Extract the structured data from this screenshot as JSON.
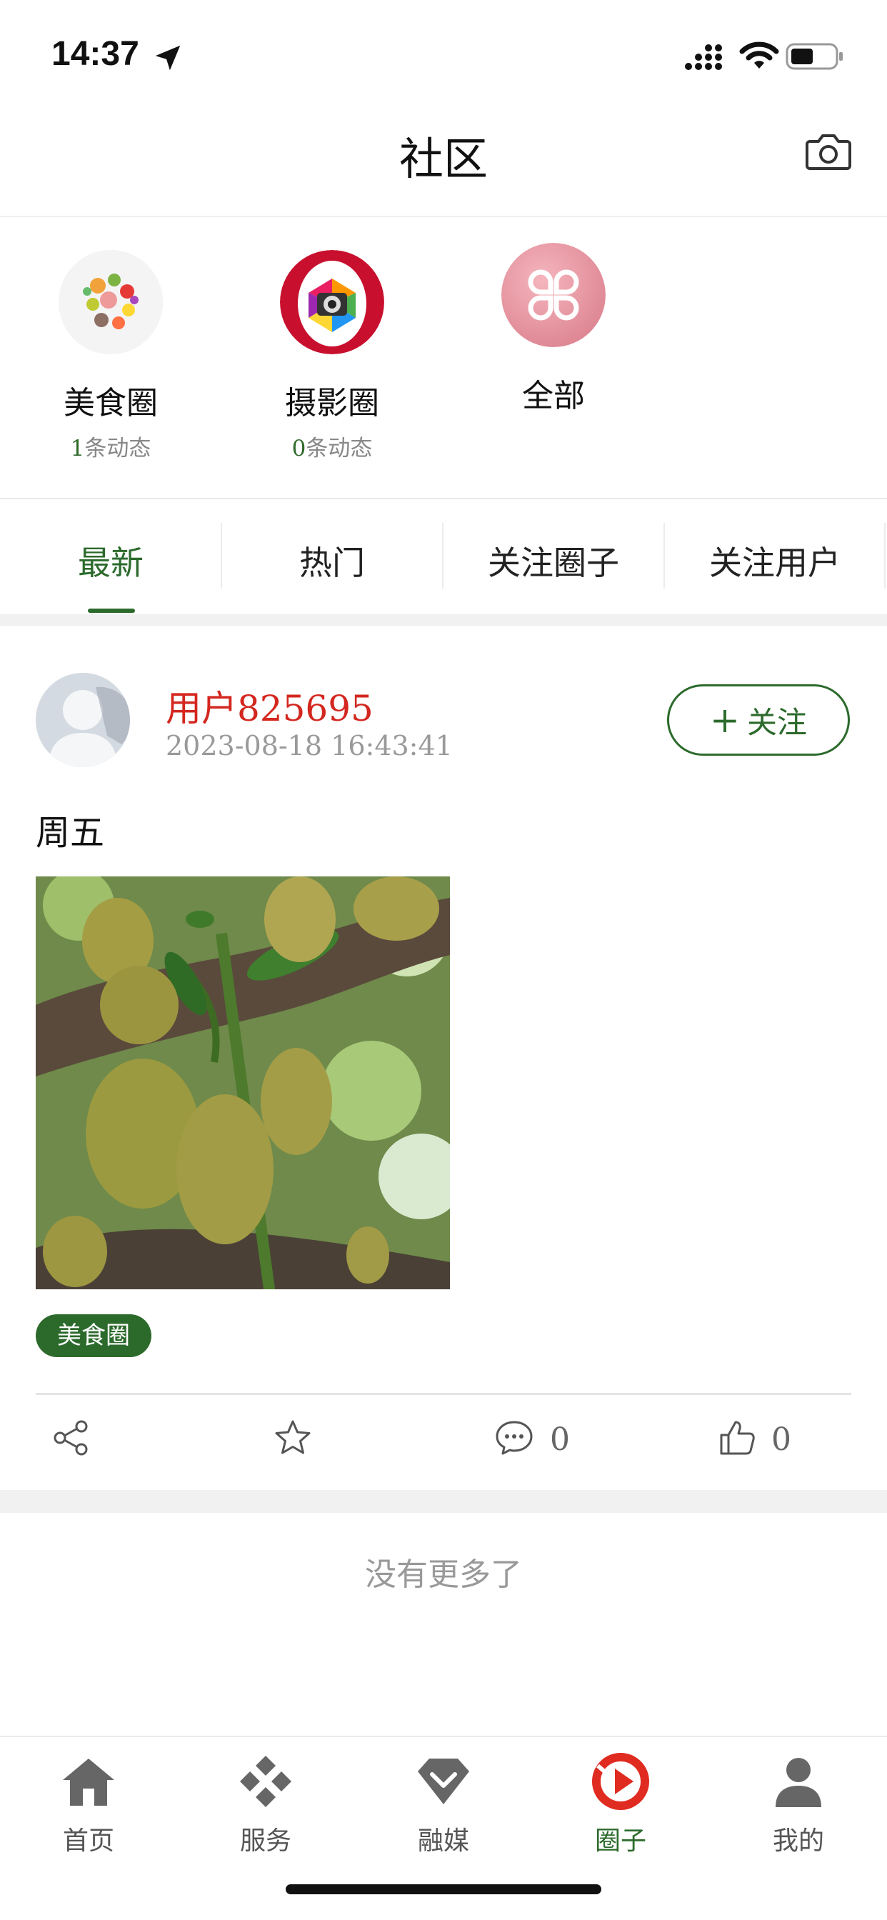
{
  "status_bar": {
    "time": "14:37"
  },
  "header": {
    "title": "社区"
  },
  "circles": [
    {
      "name": "美食圈",
      "count": "1",
      "count_suffix": "条动态"
    },
    {
      "name": "摄影圈",
      "count": "0",
      "count_suffix": "条动态"
    },
    {
      "name": "全部"
    }
  ],
  "tabs": [
    {
      "label": "最新",
      "active": true
    },
    {
      "label": "热门"
    },
    {
      "label": "关注圈子"
    },
    {
      "label": "关注用户"
    }
  ],
  "post": {
    "username": "用户825695",
    "time": "2023-08-18 16:43:41",
    "follow_label": "关注",
    "follow_plus": "+",
    "text": "周五",
    "tag": "美食圈",
    "comment_count": "0",
    "like_count": "0"
  },
  "feed_end": "没有更多了",
  "bottom_nav": [
    {
      "label": "首页",
      "icon": "home-icon"
    },
    {
      "label": "服务",
      "icon": "services-icon"
    },
    {
      "label": "融媒",
      "icon": "media-icon"
    },
    {
      "label": "圈子",
      "icon": "circle-icon",
      "active": true
    },
    {
      "label": "我的",
      "icon": "profile-icon"
    }
  ],
  "colors": {
    "accent": "#2c6a2c",
    "username": "#d3271f"
  }
}
